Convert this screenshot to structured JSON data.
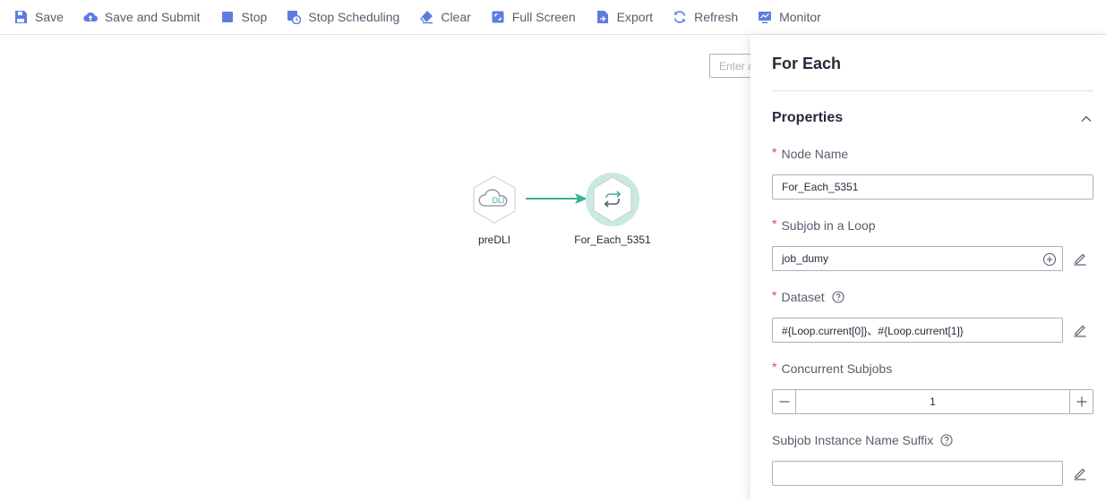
{
  "toolbar": {
    "items": [
      {
        "label": "Save",
        "icon": "save-icon"
      },
      {
        "label": "Save and Submit",
        "icon": "cloud-upload-icon"
      },
      {
        "label": "Stop",
        "icon": "stop-icon"
      },
      {
        "label": "Stop Scheduling",
        "icon": "stop-scheduling-icon"
      },
      {
        "label": "Clear",
        "icon": "eraser-icon"
      },
      {
        "label": "Full Screen",
        "icon": "fullscreen-icon"
      },
      {
        "label": "Export",
        "icon": "export-icon"
      },
      {
        "label": "Refresh",
        "icon": "refresh-icon"
      },
      {
        "label": "Monitor",
        "icon": "monitor-icon"
      }
    ]
  },
  "canvas": {
    "search_placeholder": "Enter a",
    "nodes": [
      {
        "label": "preDLI",
        "icon_text": "DLI"
      },
      {
        "label": "For_Each_5351"
      }
    ]
  },
  "panel": {
    "title": "For Each",
    "section_title": "Properties",
    "fields": {
      "node_name": {
        "label": "Node Name",
        "value": "For_Each_5351"
      },
      "subjob": {
        "label": "Subjob in a Loop",
        "value": "job_dumy"
      },
      "dataset": {
        "label": "Dataset",
        "value": "#{Loop.current[0]}、#{Loop.current[1]}"
      },
      "concurrent": {
        "label": "Concurrent Subjobs",
        "value": "1"
      },
      "suffix": {
        "label": "Subjob Instance Name Suffix",
        "value": ""
      }
    }
  },
  "colors": {
    "accent": "#5e7ce0",
    "teal": "#3cb09a",
    "required": "#e54545"
  }
}
